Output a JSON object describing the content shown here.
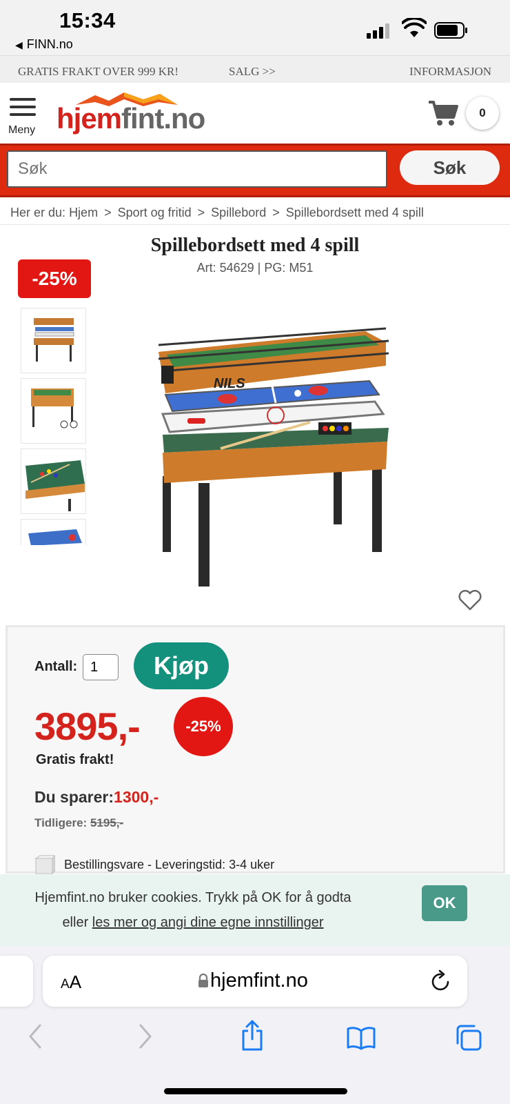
{
  "status_bar": {
    "time": "15:34",
    "back_app": "FINN.no"
  },
  "promo_bar": {
    "free_shipping": "GRATIS FRAKT OVER 999 KR!",
    "sale": "SALG >>",
    "info": "INFORMASJON"
  },
  "header": {
    "menu_label": "Meny",
    "logo_part1": "hjem",
    "logo_part2": "fint.no",
    "cart_count": "0"
  },
  "search": {
    "placeholder": "Søk",
    "button_label": "Søk"
  },
  "breadcrumb": {
    "prefix": "Her er du:",
    "items": [
      "Hjem",
      "Sport og fritid",
      "Spillebord",
      "Spillebordsett med 4 spill"
    ]
  },
  "product": {
    "title": "Spillebordsett med 4 spill",
    "article_info": "Art: 54629 | PG: M51",
    "discount_badge": "-25%",
    "quantity_label": "Antall:",
    "quantity_value": "1",
    "buy_label": "Kjøp",
    "price": "3895,-",
    "discount_circle": "-25%",
    "free_shipping": "Gratis frakt!",
    "saving_label": "Du sparer:",
    "saving_amount": "1300,-",
    "previous_label": "Tidligere:",
    "previous_price": "5195,-",
    "delivery": "Bestillingsvare - Leveringstid: 3-4 uker"
  },
  "cookie_banner": {
    "line1": "Hjemfint.no bruker cookies. Trykk på OK for å godta",
    "line2_prefix": "eller",
    "line2_link": "les mer og angi dine egne innstillinger",
    "ok_label": "OK"
  },
  "browser": {
    "text_size_label": "AA",
    "url": "hjemfint.no"
  },
  "colors": {
    "brand_red": "#d3231c",
    "buy_green": "#14917d",
    "ok_teal": "#4a9a8a",
    "cookie_bg": "#e9f3f0"
  }
}
